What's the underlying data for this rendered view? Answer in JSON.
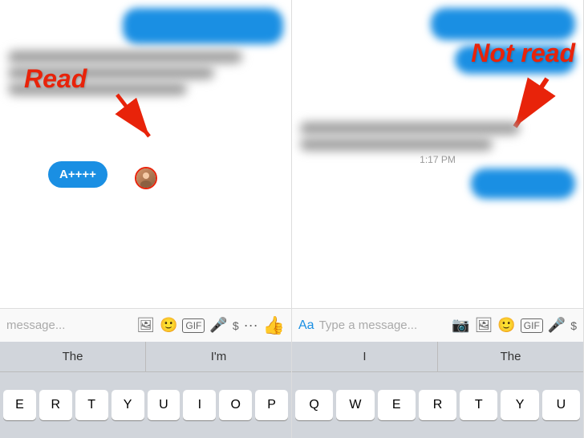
{
  "left_panel": {
    "read_label": "Read",
    "message_bubble": "A++++",
    "input_placeholder": "message...",
    "autocomplete": [
      "The",
      "I'm"
    ],
    "keys": [
      "E",
      "R",
      "T",
      "Y",
      "U",
      "I",
      "O",
      "P"
    ]
  },
  "right_panel": {
    "not_read_label": "Not read",
    "time_label": "1:17 PM",
    "input_placeholder": "Type a message...",
    "autocomplete": [
      "I",
      "The"
    ],
    "keys": [
      "Q",
      "W",
      "E",
      "R",
      "T",
      "Y",
      "U"
    ]
  },
  "colors": {
    "accent_blue": "#1a8fe3",
    "accent_red": "#e8230a",
    "keyboard_bg": "#d1d5db",
    "text_gray": "#aaa"
  }
}
